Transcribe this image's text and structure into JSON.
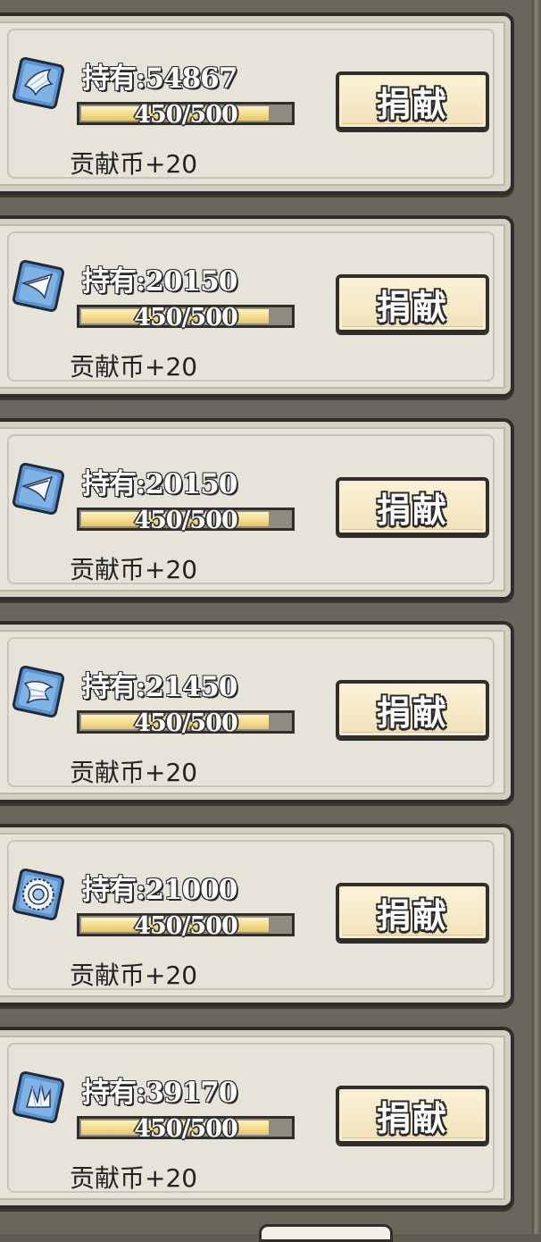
{
  "items": [
    {
      "icon": "wing-icon",
      "owned_label": "持有:54867",
      "progress_text": "450/500",
      "progress_value": 0.9,
      "reward": "贡献币+20",
      "button_label": "捐献"
    },
    {
      "icon": "feather-icon",
      "owned_label": "持有:20150",
      "progress_text": "450/500",
      "progress_value": 0.9,
      "reward": "贡献币+20",
      "button_label": "捐献"
    },
    {
      "icon": "feather-icon",
      "owned_label": "持有:20150",
      "progress_text": "450/500",
      "progress_value": 0.9,
      "reward": "贡献币+20",
      "button_label": "捐献"
    },
    {
      "icon": "scroll-icon",
      "owned_label": "持有:21450",
      "progress_text": "450/500",
      "progress_value": 0.9,
      "reward": "贡献币+20",
      "button_label": "捐献"
    },
    {
      "icon": "gear-disc-icon",
      "owned_label": "持有:21000",
      "progress_text": "450/500",
      "progress_value": 0.9,
      "reward": "贡献币+20",
      "button_label": "捐献"
    },
    {
      "icon": "crystal-icon",
      "owned_label": "持有:39170",
      "progress_text": "450/500",
      "progress_value": 0.9,
      "reward": "贡献币+20",
      "button_label": "捐献"
    }
  ]
}
